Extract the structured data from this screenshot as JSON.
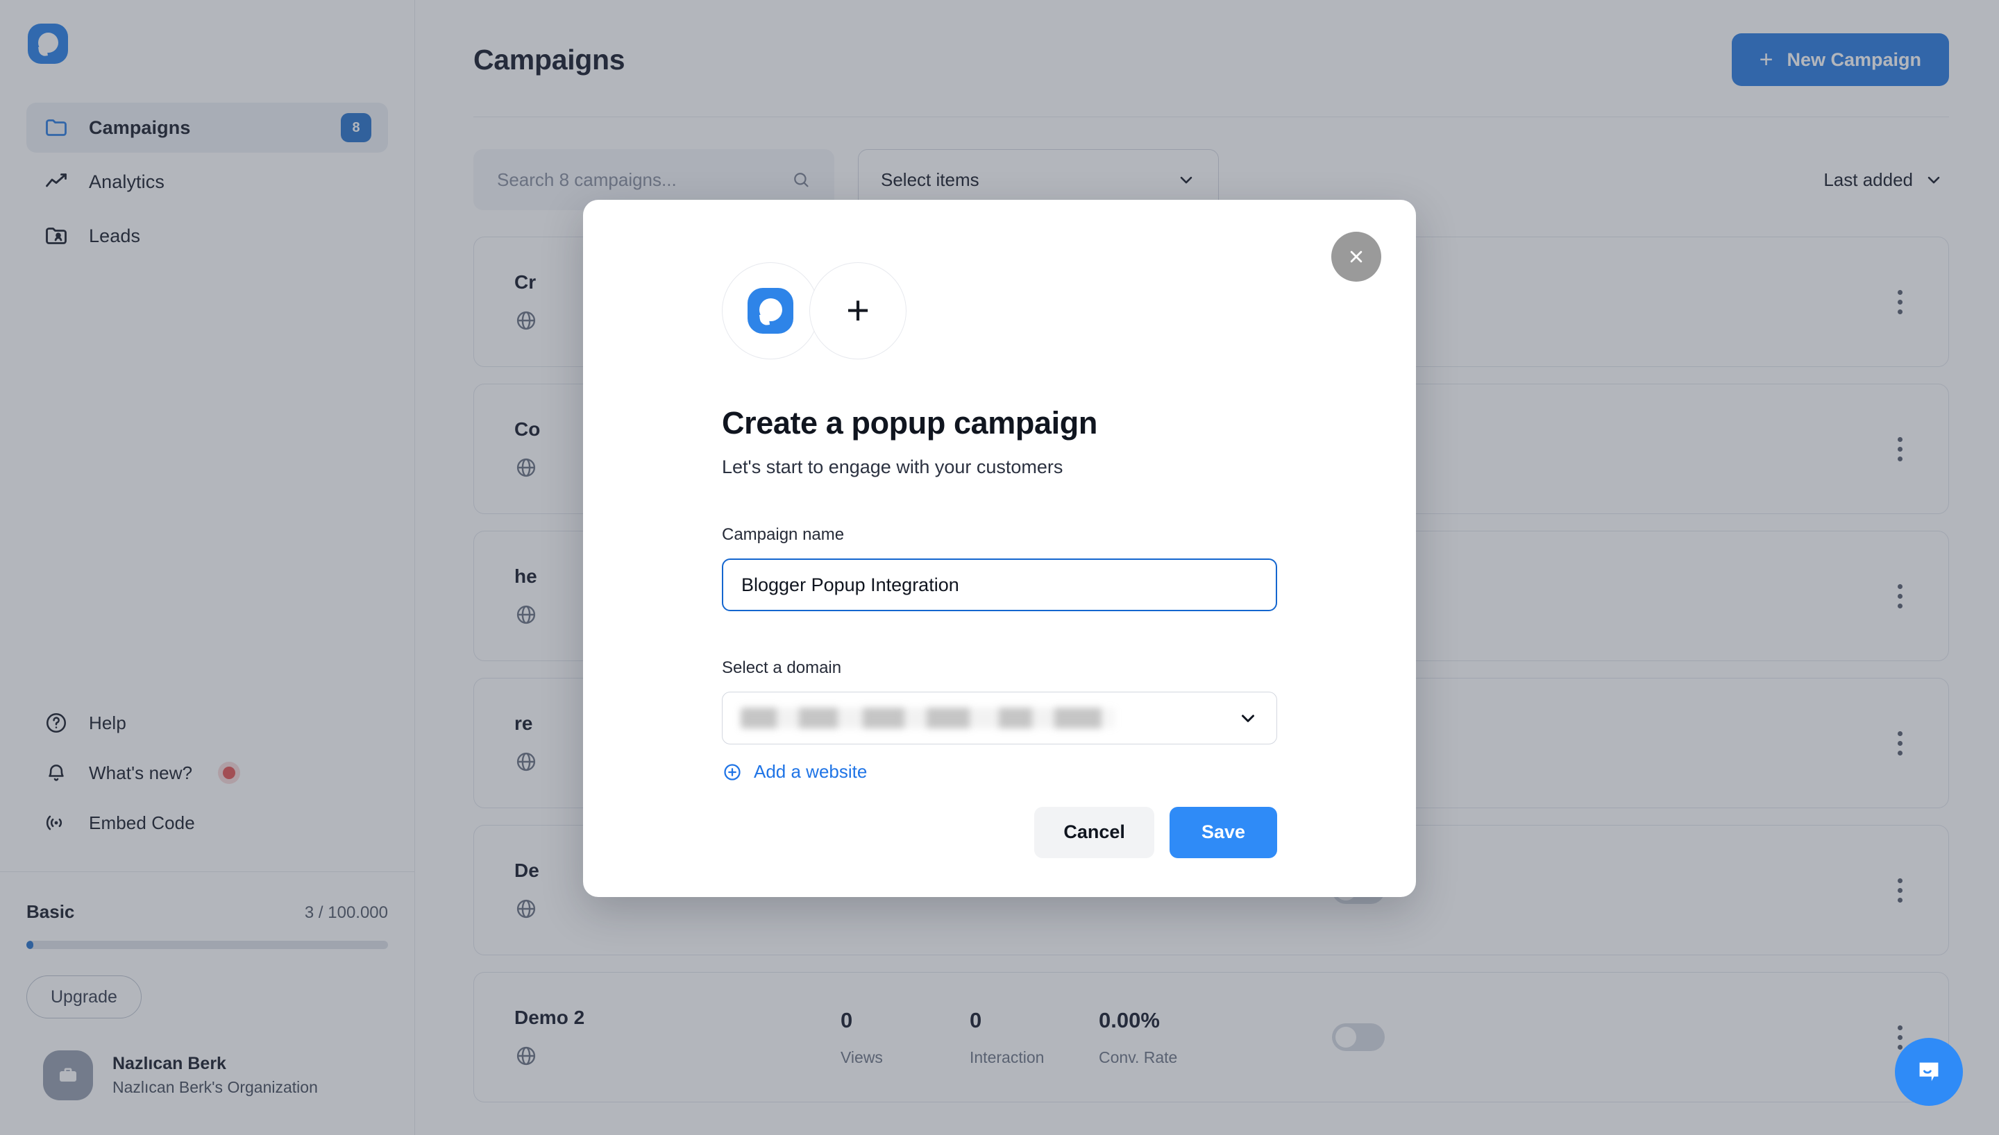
{
  "sidebar": {
    "logo_icon": "popupsmart-logo-icon",
    "nav_items": [
      {
        "label": "Campaigns",
        "icon": "folder-icon",
        "badge": "8",
        "active": true
      },
      {
        "label": "Analytics",
        "icon": "line-chart-icon",
        "badge": "",
        "active": false
      },
      {
        "label": "Leads",
        "icon": "folder-user-icon",
        "badge": "",
        "active": false
      }
    ],
    "secondary_items": [
      {
        "label": "Help",
        "icon": "question-circle-icon",
        "dot": false
      },
      {
        "label": "What's new?",
        "icon": "bell-icon",
        "dot": true
      },
      {
        "label": "Embed Code",
        "icon": "broadcast-icon",
        "dot": false
      }
    ],
    "plan": {
      "name": "Basic",
      "usage": "3 / 100.000",
      "progress_percent": 2,
      "upgrade_label": "Upgrade"
    },
    "profile": {
      "name": "Nazlıcan Berk",
      "organization": "Nazlıcan Berk's Organization",
      "avatar_icon": "briefcase-icon"
    }
  },
  "main": {
    "page_title": "Campaigns",
    "new_campaign_label": "New Campaign",
    "new_campaign_icon": "plus-icon",
    "toolbar": {
      "search_placeholder": "Search 8 campaigns...",
      "search_value": "",
      "search_icon": "search-icon",
      "select_items_label": "Select items",
      "select_items_icon": "chevron-down-icon",
      "sort_label": "Last added",
      "sort_icon": "chevron-down-icon"
    },
    "columns": [
      "Views",
      "Interaction",
      "Conv. Rate"
    ],
    "rows": [
      {
        "name": "Cr",
        "views": "",
        "interaction": "",
        "conv_rate": "",
        "enabled": false,
        "globe_icon": "globe-icon",
        "menu_icon": "kebab-menu-icon"
      },
      {
        "name": "Co",
        "views": "",
        "interaction": "",
        "conv_rate": "",
        "enabled": true,
        "globe_icon": "globe-icon",
        "menu_icon": "kebab-menu-icon"
      },
      {
        "name": "he",
        "views": "",
        "interaction": "",
        "conv_rate": "",
        "enabled": false,
        "globe_icon": "globe-icon",
        "menu_icon": "kebab-menu-icon"
      },
      {
        "name": "re",
        "views": "",
        "interaction": "",
        "conv_rate": "",
        "enabled": false,
        "globe_icon": "globe-icon",
        "menu_icon": "kebab-menu-icon"
      },
      {
        "name": "De",
        "views": "",
        "interaction": "",
        "conv_rate": "",
        "enabled": false,
        "globe_icon": "globe-icon",
        "menu_icon": "kebab-menu-icon"
      },
      {
        "name": "Demo 2",
        "views": "0",
        "interaction": "0",
        "conv_rate": "0.00%",
        "enabled": false,
        "globe_icon": "globe-icon",
        "menu_icon": "kebab-menu-icon"
      }
    ]
  },
  "modal": {
    "close_icon": "close-icon",
    "logo_icon": "popupsmart-logo-icon",
    "plus_icon": "plus-icon",
    "title": "Create a popup campaign",
    "subtitle": "Let's start to engage with your customers",
    "campaign_name_label": "Campaign name",
    "campaign_name_value": "Blogger Popup Integration",
    "campaign_name_placeholder": "Campaign name",
    "domain_label": "Select a domain",
    "domain_value": "",
    "domain_chevron_icon": "chevron-down-icon",
    "add_website_label": "Add a website",
    "add_website_icon": "plus-circle-icon",
    "cancel_label": "Cancel",
    "save_label": "Save"
  },
  "chat_widget": {
    "icon": "chat-bubble-icon"
  },
  "colors": {
    "accent_blue": "#2f8bf7",
    "brand_blue": "#2e84e8",
    "button_blue": "#2f7fe0",
    "focus_border": "#1466cf",
    "notification_red": "#e45757"
  }
}
